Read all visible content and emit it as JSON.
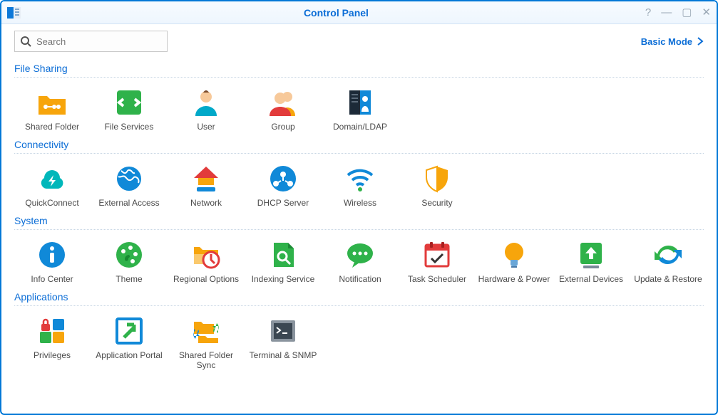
{
  "window": {
    "title": "Control Panel"
  },
  "toolbar": {
    "search_placeholder": "Search",
    "basic_mode_label": "Basic Mode"
  },
  "sections": {
    "file_sharing": {
      "title": "File Sharing",
      "items": {
        "shared_folder": "Shared Folder",
        "file_services": "File Services",
        "user": "User",
        "group": "Group",
        "domain_ldap": "Domain/LDAP"
      }
    },
    "connectivity": {
      "title": "Connectivity",
      "items": {
        "quickconnect": "QuickConnect",
        "external_access": "External Access",
        "network": "Network",
        "dhcp_server": "DHCP Server",
        "wireless": "Wireless",
        "security": "Security"
      }
    },
    "system": {
      "title": "System",
      "items": {
        "info_center": "Info Center",
        "theme": "Theme",
        "regional_options": "Regional Options",
        "indexing_service": "Indexing Service",
        "notification": "Notification",
        "task_scheduler": "Task Scheduler",
        "hardware_power": "Hardware & Power",
        "external_devices": "External Devices",
        "update_restore": "Update & Restore"
      }
    },
    "applications": {
      "title": "Applications",
      "items": {
        "privileges": "Privileges",
        "application_portal": "Application Portal",
        "shared_folder_sync": "Shared Folder Sync",
        "terminal_snmp": "Terminal & SNMP"
      }
    }
  }
}
